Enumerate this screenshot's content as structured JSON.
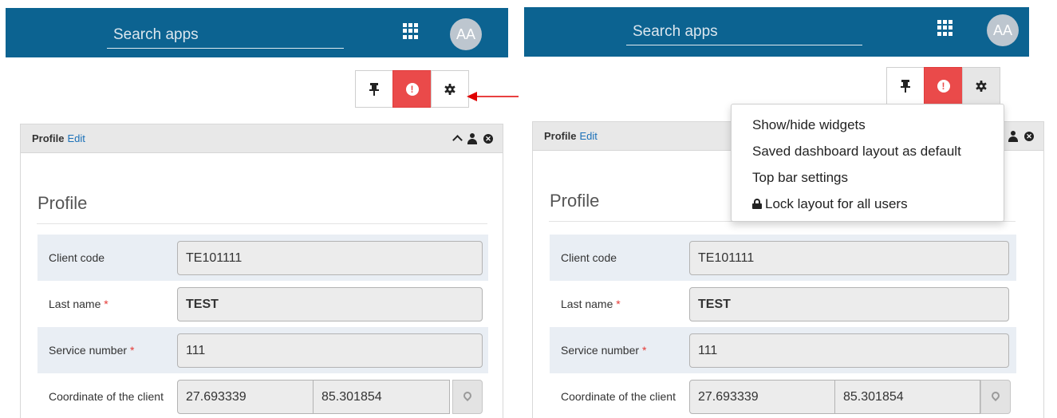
{
  "topbar": {
    "search_placeholder": "Search apps",
    "avatar_initials": "AA",
    "color": "#0c6391"
  },
  "toolbar": {
    "pin_icon": "pushpin-icon",
    "alert_icon": "exclamation-icon",
    "settings_icon": "gear-icon",
    "alert_color": "#ea4a4a"
  },
  "annotation": {
    "arrow_color": "#e00000"
  },
  "widget": {
    "title": "Profile",
    "edit_label": "Edit",
    "section_title": "Profile"
  },
  "form": {
    "client_code": {
      "label": "Client code",
      "value": "TE101111"
    },
    "last_name": {
      "label": "Last name",
      "required": "*",
      "value": "TEST"
    },
    "service_number": {
      "label": "Service number",
      "required": "*",
      "value": "111"
    },
    "coordinate": {
      "label": "Coordinate of the client",
      "latitude": "27.693339",
      "longitude": "85.301854"
    }
  },
  "settings_menu": {
    "items": [
      "Show/hide widgets",
      "Saved dashboard layout as default",
      "Top bar settings",
      "Lock layout for all users"
    ]
  }
}
